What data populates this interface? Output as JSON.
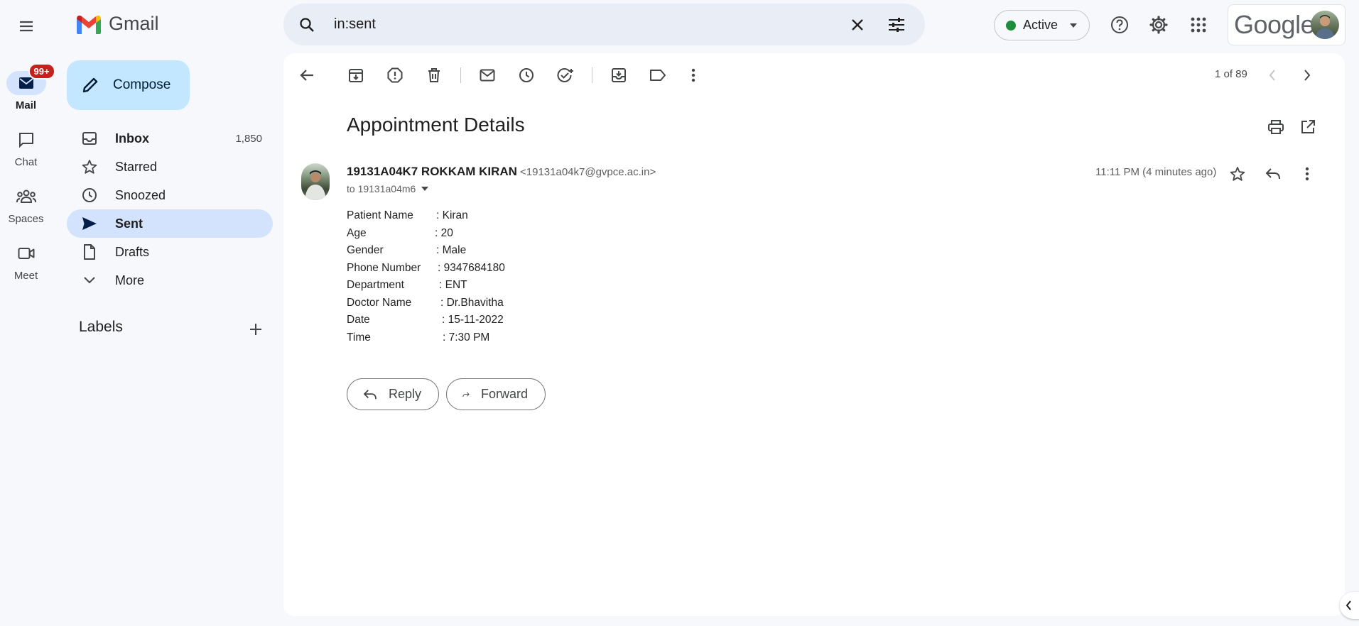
{
  "app": {
    "name": "Gmail"
  },
  "search": {
    "query": "in:sent"
  },
  "status": {
    "label": "Active"
  },
  "account": {
    "brand": "Google"
  },
  "rail": [
    {
      "label": "Mail",
      "badge": "99+"
    },
    {
      "label": "Chat"
    },
    {
      "label": "Spaces"
    },
    {
      "label": "Meet"
    }
  ],
  "compose": {
    "label": "Compose"
  },
  "nav": [
    {
      "label": "Inbox",
      "count": "1,850"
    },
    {
      "label": "Starred"
    },
    {
      "label": "Snoozed"
    },
    {
      "label": "Sent"
    },
    {
      "label": "Drafts"
    },
    {
      "label": "More"
    }
  ],
  "labels": {
    "title": "Labels"
  },
  "toolbar": {
    "pager": "1 of 89"
  },
  "message": {
    "subject": "Appointment Details",
    "sender_name": "19131A04K7 ROKKAM KIRAN",
    "sender_email": "<19131a04k7@gvpce.ac.in>",
    "to": "to 19131a04m6",
    "time": "11:11 PM (4 minutes ago)",
    "body": [
      {
        "key": "Patient Name",
        "value": ": Kiran"
      },
      {
        "key": "Age",
        "value": ": 20"
      },
      {
        "key": "Gender",
        "value": ": Male"
      },
      {
        "key": "Phone Number",
        "value": ": 9347684180"
      },
      {
        "key": "Department",
        "value": ": ENT"
      },
      {
        "key": "Doctor Name",
        "value": ": Dr.Bhavitha"
      },
      {
        "key": "Date",
        "value": ": 15-11-2022"
      },
      {
        "key": "Time",
        "value": ": 7:30 PM"
      }
    ]
  },
  "actions": {
    "reply": "Reply",
    "forward": "Forward"
  },
  "colors": {
    "accent": "#c2e7ff",
    "active_nav": "#d3e3fd",
    "badge": "#c5221f",
    "status": "#1e8e3e"
  }
}
